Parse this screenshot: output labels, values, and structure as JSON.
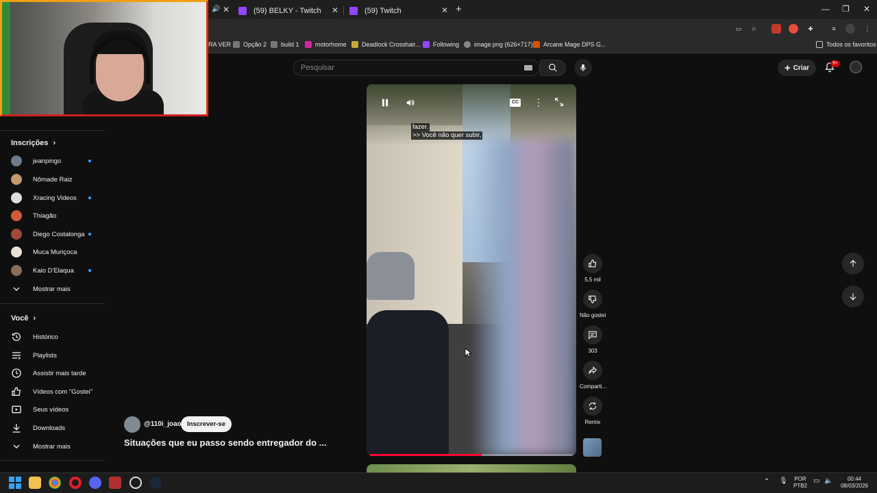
{
  "browser": {
    "tabs": [
      {
        "label": "(59) BELKY - Twitch"
      },
      {
        "label": "(59) Twitch"
      }
    ],
    "bookmarks": [
      {
        "label": "RA VER"
      },
      {
        "label": "Opção 2"
      },
      {
        "label": "build 1"
      },
      {
        "label": "motorhome"
      },
      {
        "label": "Deadlock Crosshair..."
      },
      {
        "label": "Following"
      },
      {
        "label": "image.png (626×717)"
      },
      {
        "label": "Arcane Mage DPS G..."
      }
    ],
    "all_bookmarks_label": "Todos os favoritos"
  },
  "header": {
    "search_placeholder": "Pesquisar",
    "create_label": "Criar",
    "notification_badge": "9+"
  },
  "sidebar": {
    "subscriptions_title": "Inscrições",
    "subscriptions": [
      {
        "label": "jeanpingo",
        "new": true
      },
      {
        "label": "Nômade Raiz",
        "new": false
      },
      {
        "label": "Xracing Videos",
        "new": true
      },
      {
        "label": "Thiagão",
        "new": false
      },
      {
        "label": "Diego Costalonga",
        "new": true
      },
      {
        "label": "Muca Muriçoca",
        "new": false
      },
      {
        "label": "Kaio D'Elaqua",
        "new": true
      }
    ],
    "subscriptions_more": "Mostrar mais",
    "you_title": "Você",
    "you_items": [
      {
        "label": "Histórico",
        "icon": "history-icon"
      },
      {
        "label": "Playlists",
        "icon": "playlists-icon"
      },
      {
        "label": "Assistir mais tarde",
        "icon": "watch-later-icon"
      },
      {
        "label": "Vídeos com \"Gostei\"",
        "icon": "liked-icon"
      },
      {
        "label": "Seus vídeos",
        "icon": "your-videos-icon"
      },
      {
        "label": "Downloads",
        "icon": "downloads-icon"
      }
    ],
    "you_more": "Mostrar mais"
  },
  "video": {
    "captions": [
      "fazer.",
      ">> Você não quer subir,"
    ],
    "progress": 0.55,
    "channel": "@110i_joao",
    "subscribe_label": "Inscrever-se",
    "title": "Situações que eu passo sendo entregador do ..."
  },
  "actions": {
    "likes": "5,5 mil",
    "dislike_label": "Não gostei",
    "comments": "303",
    "share_label": "Comparti...",
    "remix_label": "Remix"
  },
  "taskbar": {
    "lang_top": "POR",
    "lang_bottom": "PTB2",
    "time": "00:44",
    "date": "08/03/2026"
  },
  "colors": {
    "accent_red": "#ff0033",
    "new_dot": "#3ea6ff",
    "webcam_border": "#f0a010"
  }
}
